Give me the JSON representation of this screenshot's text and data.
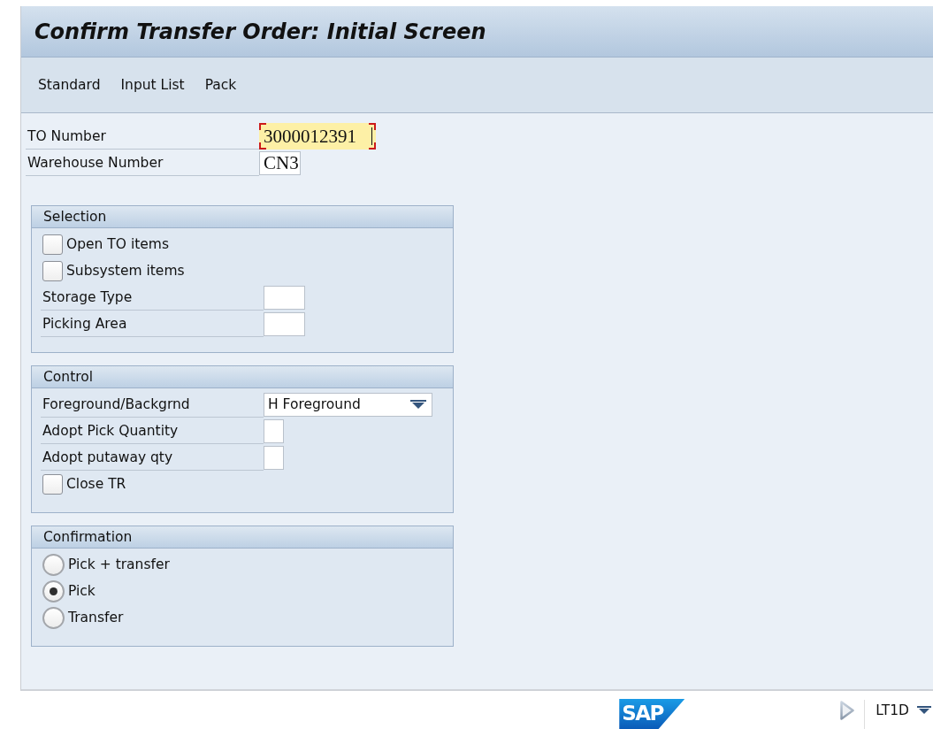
{
  "window": {
    "title": "Confirm Transfer Order: Initial Screen"
  },
  "toolbar": {
    "buttons": [
      "Standard",
      "Input List",
      "Pack"
    ]
  },
  "header_fields": [
    {
      "label": "TO Number",
      "kind": "number",
      "value": "3000012391",
      "focused": true
    },
    {
      "label": "Warehouse Number",
      "kind": "code",
      "value": "CN3",
      "focused": false
    }
  ],
  "groups": [
    {
      "title": "Selection",
      "items": [
        {
          "kind": "checkbox",
          "label": "Open TO items",
          "checked": false
        },
        {
          "kind": "checkbox",
          "label": "Subsystem items",
          "checked": false
        },
        {
          "kind": "code",
          "label": "Storage Type"
        },
        {
          "kind": "code",
          "label": "Picking Area"
        }
      ]
    },
    {
      "title": "Control",
      "items": [
        {
          "kind": "dropdown",
          "label": "Foreground/Backgrnd",
          "value": "H Foreground"
        },
        {
          "kind": "flag",
          "label": "Adopt Pick Quantity"
        },
        {
          "kind": "flag",
          "label": "Adopt putaway qty"
        },
        {
          "kind": "checkbox",
          "label": "Close TR",
          "checked": false
        }
      ]
    },
    {
      "title": "Confirmation",
      "items": [
        {
          "kind": "radio",
          "label": "Pick + transfer",
          "selected": false
        },
        {
          "kind": "radio",
          "label": "Pick",
          "selected": true
        },
        {
          "kind": "radio",
          "label": "Transfer",
          "selected": false
        }
      ]
    }
  ],
  "status_bar": {
    "logo": "SAP",
    "system": "LT1D"
  }
}
